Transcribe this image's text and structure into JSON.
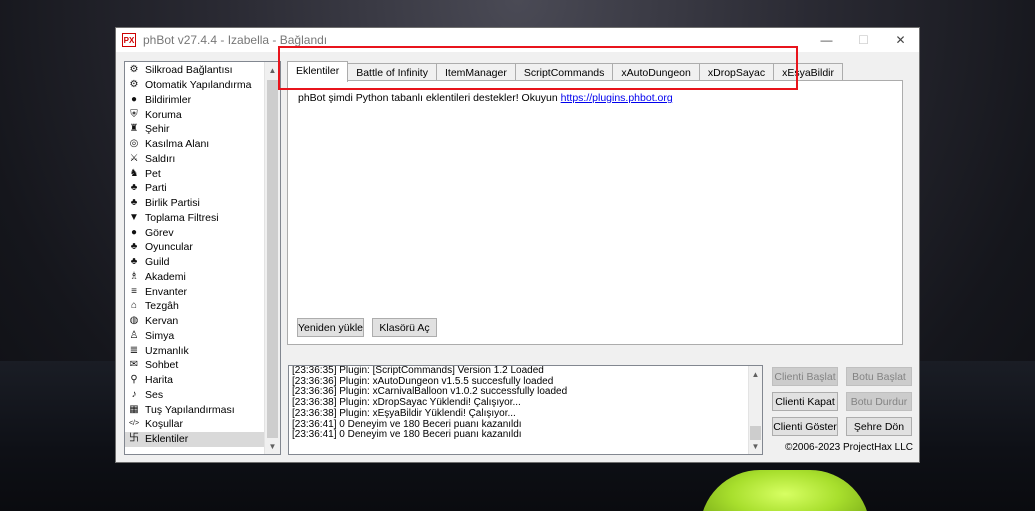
{
  "window": {
    "title": "phBot v27.4.4 - Izabella - Bağlandı",
    "app_icon_text": "PX",
    "controls": {
      "close": "✕",
      "maximize": "☐",
      "minimize": "—"
    }
  },
  "sidebar": {
    "items": [
      {
        "label": "Silkroad Bağlantısı",
        "icon": "gears-icon",
        "glyph": "⚙"
      },
      {
        "label": "Otomatik Yapılandırma",
        "icon": "gear-icon",
        "glyph": "⚙"
      },
      {
        "label": "Bildirimler",
        "icon": "notification-icon",
        "glyph": "●"
      },
      {
        "label": "Koruma",
        "icon": "shield-icon",
        "glyph": "⛨"
      },
      {
        "label": "Şehir",
        "icon": "town-icon",
        "glyph": "♜"
      },
      {
        "label": "Kasılma Alanı",
        "icon": "target-icon",
        "glyph": "◎"
      },
      {
        "label": "Saldırı",
        "icon": "sword-icon",
        "glyph": "⚔"
      },
      {
        "label": "Pet",
        "icon": "pet-icon",
        "glyph": "♞"
      },
      {
        "label": "Parti",
        "icon": "party-icon",
        "glyph": "♣"
      },
      {
        "label": "Birlik Partisi",
        "icon": "union-party-icon",
        "glyph": "♣"
      },
      {
        "label": "Toplama Filtresi",
        "icon": "filter-icon",
        "glyph": "▼"
      },
      {
        "label": "Görev",
        "icon": "quest-icon",
        "glyph": "●"
      },
      {
        "label": "Oyuncular",
        "icon": "players-icon",
        "glyph": "♣"
      },
      {
        "label": "Guild",
        "icon": "guild-icon",
        "glyph": "♣"
      },
      {
        "label": "Akademi",
        "icon": "academy-icon",
        "glyph": "♗"
      },
      {
        "label": "Envanter",
        "icon": "inventory-icon",
        "glyph": "≡"
      },
      {
        "label": "Tezgâh",
        "icon": "stall-icon",
        "glyph": "⌂"
      },
      {
        "label": "Kervan",
        "icon": "caravan-icon",
        "glyph": "◍"
      },
      {
        "label": "Simya",
        "icon": "alchemy-icon",
        "glyph": "♙"
      },
      {
        "label": "Uzmanlık",
        "icon": "mastery-icon",
        "glyph": "≣"
      },
      {
        "label": "Sohbet",
        "icon": "chat-icon",
        "glyph": "✉"
      },
      {
        "label": "Harita",
        "icon": "map-pin-icon",
        "glyph": "⚲"
      },
      {
        "label": "Ses",
        "icon": "bell-icon",
        "glyph": "♪"
      },
      {
        "label": "Tuş Yapılandırması",
        "icon": "keyboard-icon",
        "glyph": "▦"
      },
      {
        "label": "Koşullar",
        "icon": "code-icon",
        "glyph": "</>"
      },
      {
        "label": "Eklentiler",
        "icon": "plugin-icon",
        "glyph": "卐"
      }
    ],
    "selected_index": 25
  },
  "tabs": [
    {
      "label": "Eklentiler",
      "active": true
    },
    {
      "label": "Battle of Infinity",
      "active": false
    },
    {
      "label": "ItemManager",
      "active": false
    },
    {
      "label": "ScriptCommands",
      "active": false
    },
    {
      "label": "xAutoDungeon",
      "active": false
    },
    {
      "label": "xDropSayac",
      "active": false
    },
    {
      "label": "xEşyaBildir",
      "active": false
    }
  ],
  "panel": {
    "text": "phBot şimdi Python tabanlı eklentileri destekler! Okuyun ",
    "link": "https://plugins.phbot.org",
    "reload_button": "Yeniden yükle",
    "folder_button": "Klasörü Aç"
  },
  "log": {
    "lines": [
      "[23:36:35] Plugin: [ScriptCommands] Version 1.2 Loaded",
      "[23:36:36] Plugin: xAutoDungeon v1.5.5 succesfully loaded",
      "[23:36:36] Plugin: xCarnivalBalloon v1.0.2 successfully loaded",
      "[23:36:38] Plugin: xDropSayac Yüklendi! Çalışıyor...",
      "[23:36:38] Plugin: xEşyaBildir Yüklendi! Çalışıyor...",
      "[23:36:41] 0 Deneyim ve 180 Beceri puanı kazanıldı",
      "[23:36:41] 0 Deneyim ve 180 Beceri puanı kazanıldı"
    ]
  },
  "controls": {
    "start_client": "Clienti Başlat",
    "start_bot": "Botu Başlat",
    "kill_client": "Clienti Kapat",
    "stop_bot": "Botu Durdur",
    "show_client": "Clienti Göster",
    "return_town": "Şehre Dön"
  },
  "copyright": "©2006-2023 ProjectHax LLC",
  "colors": {
    "highlight": "#e8141c",
    "link": "#0000ee"
  }
}
